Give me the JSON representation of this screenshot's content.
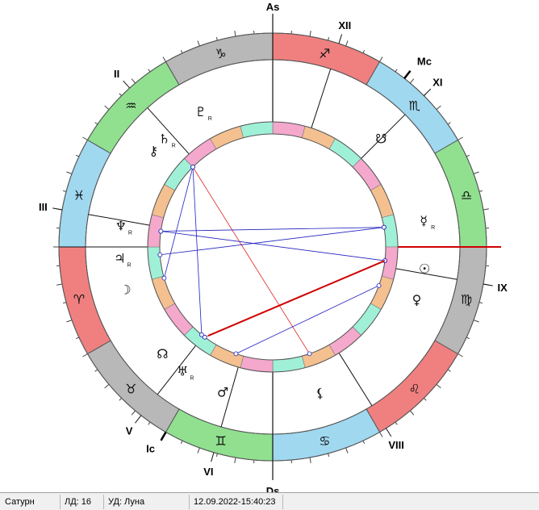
{
  "chart": {
    "ascendant_label": "As",
    "descendant_label": "Ds",
    "mc_label": "Mc",
    "ic_label": "Ic",
    "houses": [
      {
        "label": "XII",
        "degree": 18
      },
      {
        "label": "XI",
        "degree": 45
      },
      {
        "label": "IX",
        "degree": 100
      },
      {
        "label": "VIII",
        "degree": 148
      },
      {
        "label": "VI",
        "degree": 196
      },
      {
        "label": "V",
        "degree": 218
      },
      {
        "label": "III",
        "degree": 280
      },
      {
        "label": "II",
        "degree": 318
      }
    ],
    "signs": [
      {
        "glyph": "♐",
        "color": "#f08080",
        "start": 0
      },
      {
        "glyph": "♏",
        "color": "#a0d8f0",
        "start": 30
      },
      {
        "glyph": "♎",
        "color": "#90e090",
        "start": 60
      },
      {
        "glyph": "♍",
        "color": "#b8b8b8",
        "start": 90
      },
      {
        "glyph": "♌",
        "color": "#f08080",
        "start": 120
      },
      {
        "glyph": "♋",
        "color": "#a0d8f0",
        "start": 150
      },
      {
        "glyph": "♊",
        "color": "#90e090",
        "start": 180
      },
      {
        "glyph": "♉",
        "color": "#b8b8b8",
        "start": 210
      },
      {
        "glyph": "♈",
        "color": "#f08080",
        "start": 240
      },
      {
        "glyph": "♓",
        "color": "#a0d8f0",
        "start": 270
      },
      {
        "glyph": "♒",
        "color": "#90e090",
        "start": 300
      },
      {
        "glyph": "♑",
        "color": "#b8b8b8",
        "start": 330
      }
    ],
    "planets": [
      {
        "glyph": "♇",
        "retro": "R",
        "deg": 332
      },
      {
        "glyph": "♄",
        "retro": "R",
        "deg": 315
      },
      {
        "glyph": "⚷",
        "retro": "",
        "deg": 309
      },
      {
        "glyph": "♆",
        "retro": "R",
        "deg": 278
      },
      {
        "glyph": "♃",
        "retro": "R",
        "deg": 266
      },
      {
        "glyph": "☽",
        "retro": "",
        "deg": 254
      },
      {
        "glyph": "☊",
        "retro": "",
        "deg": 226
      },
      {
        "glyph": "♅",
        "retro": "R",
        "deg": 216
      },
      {
        "glyph": "♂",
        "retro": "",
        "deg": 199
      },
      {
        "glyph": "⚸",
        "retro": "",
        "deg": 162
      },
      {
        "glyph": "♀",
        "retro": "",
        "deg": 110
      },
      {
        "glyph": "☉",
        "retro": "",
        "deg": 98
      },
      {
        "glyph": "☿",
        "retro": "R",
        "deg": 80
      },
      {
        "glyph": "☋",
        "retro": "",
        "deg": 45
      }
    ],
    "aspects": [
      {
        "from": 315,
        "to": 254,
        "color": "#2020c0"
      },
      {
        "from": 315,
        "to": 219,
        "color": "#2020c0"
      },
      {
        "from": 315,
        "to": 161,
        "color": "#e02020"
      },
      {
        "from": 278,
        "to": 80,
        "color": "#2020c0"
      },
      {
        "from": 278,
        "to": 97,
        "color": "#2020c0"
      },
      {
        "from": 266,
        "to": 80,
        "color": "#2020c0"
      },
      {
        "from": 217,
        "to": 97,
        "color": "#e02020"
      },
      {
        "from": 199,
        "to": 110,
        "color": "#2020c0"
      }
    ]
  },
  "statusbar": {
    "planet": "Сатурн",
    "ld": "ЛД: 16",
    "ud": "УД: Луна",
    "datetime": "12.09.2022-15:40:23"
  }
}
